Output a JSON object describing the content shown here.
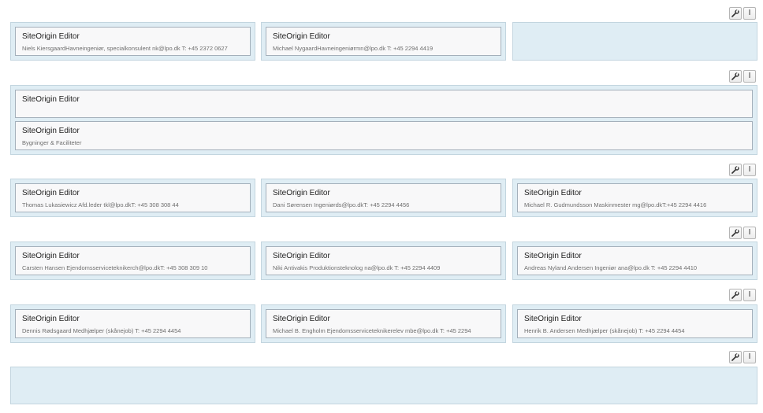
{
  "toolbar": {
    "settings_icon": "wrench-icon",
    "move_icon": "i-beam-icon",
    "move_glyph": "I"
  },
  "rows": [
    {
      "widgets": [
        {
          "title": "SiteOrigin Editor",
          "description": "Niels KiersgaardHavneingeniør, specialkonsulent nk@lpo.dk T: +45 2372 0627"
        },
        {
          "title": "SiteOrigin Editor",
          "description": " Michael NygaardHavneingeniørmn@lpo.dk T: +45 2294 4419"
        }
      ]
    },
    {
      "widgets": [
        {
          "title": "SiteOrigin Editor",
          "description": ""
        },
        {
          "title": "SiteOrigin Editor",
          "description": "Bygninger & Faciliteter"
        }
      ]
    },
    {
      "widgets": [
        {
          "title": "SiteOrigin Editor",
          "description": "Thomas Lukasiewicz Afd.leder tkl@lpo.dkT: +45 308 308 44"
        },
        {
          "title": "SiteOrigin Editor",
          "description": "Dani Sørensen Ingeniørds@lpo.dkT: +45 2294 4456"
        },
        {
          "title": "SiteOrigin Editor",
          "description": "Michael R. Gudmundsson Maskinmester mg@lpo.dkT:+45 2294 4416"
        }
      ]
    },
    {
      "widgets": [
        {
          "title": "SiteOrigin Editor",
          "description": "Carsten Hansen Ejendomsserviceteknikerch@lpo.dkT: +45 308 309 10"
        },
        {
          "title": "SiteOrigin Editor",
          "description": "Niki Antivakis Produktionsteknolog na@lpo.dk T: +45 2294 4409"
        },
        {
          "title": "SiteOrigin Editor",
          "description": "Andreas Nyland Andersen Ingeniør ana@lpo.dk T: +45 2294 4410"
        }
      ]
    },
    {
      "widgets": [
        {
          "title": "SiteOrigin Editor",
          "description": "Dennis Rødsgaard Medhjælper (skånejob) T: +45 2294 4454"
        },
        {
          "title": "SiteOrigin Editor",
          "description": "Michael B. Engholm Ejendomsserviceteknikerelev mbe@lpo.dk T: +45 2294"
        },
        {
          "title": "SiteOrigin Editor",
          "description": "Henrik B. Andersen Medhjælper (skånejob) T: +45 2294 4454"
        }
      ]
    },
    {
      "widgets": []
    }
  ]
}
